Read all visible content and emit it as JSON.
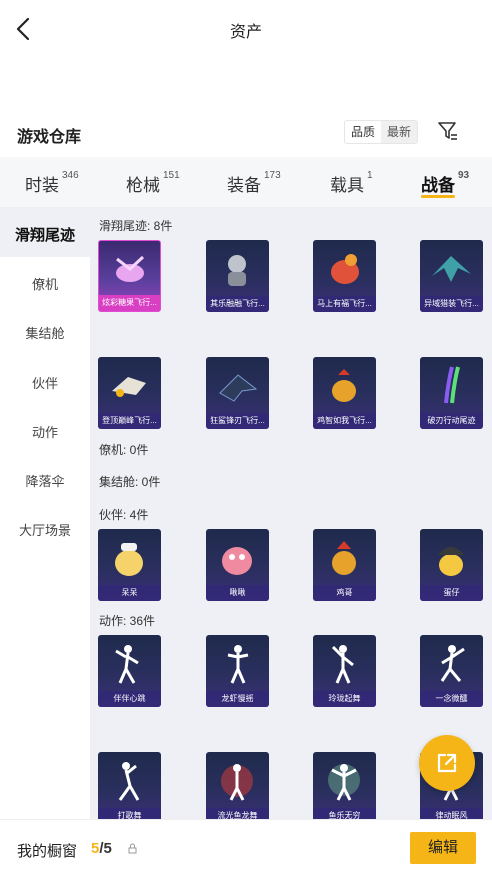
{
  "header": {
    "title": "资产",
    "back_icon": "chevron-left-icon"
  },
  "warehouse": {
    "title": "游戏仓库",
    "sort_options": [
      "品质",
      "最新"
    ],
    "filter_icon": "filter-icon"
  },
  "tabs": [
    {
      "label": "时装",
      "count": "346"
    },
    {
      "label": "枪械",
      "count": "151"
    },
    {
      "label": "装备",
      "count": "173"
    },
    {
      "label": "载具",
      "count": "1"
    },
    {
      "label": "战备",
      "count": "93",
      "active": true
    }
  ],
  "sidebar": [
    {
      "label": "滑翔尾迹",
      "active": true
    },
    {
      "label": "僚机"
    },
    {
      "label": "集结舱"
    },
    {
      "label": "伙伴"
    },
    {
      "label": "动作"
    },
    {
      "label": "降落伞"
    },
    {
      "label": "大厅场景"
    }
  ],
  "sections": {
    "glide": {
      "label": "滑翔尾迹: 8件",
      "items": [
        "炫彩糖果飞行...",
        "其乐融融飞行...",
        "马上有福飞行...",
        "异域猎装飞行...",
        "登顶巅峰飞行...",
        "狂鲨锋刃飞行...",
        "鸡智如我飞行...",
        "破刃行动尾迹"
      ]
    },
    "wingman": {
      "label": "僚机: 0件"
    },
    "pod": {
      "label": "集结舱: 0件"
    },
    "partner": {
      "label": "伙伴: 4件",
      "items": [
        "呆呆",
        "啾啾",
        "鸡哥",
        "蛋仔"
      ]
    },
    "action": {
      "label": "动作: 36件",
      "items": [
        "伴伴心跳",
        "龙虾慢摇",
        "玲珑起舞",
        "一念微醺",
        "打歌舞",
        "流光鱼龙舞",
        "鱼乐无穷",
        "律动眠风"
      ]
    }
  },
  "bottom": {
    "label": "我的橱窗",
    "count_current": "5",
    "count_total": "/5",
    "edit_label": "编辑"
  },
  "colors": {
    "accent": "#f5b517",
    "highlight_card": "#d83fc3",
    "card_bg": "#2a2f5e"
  }
}
